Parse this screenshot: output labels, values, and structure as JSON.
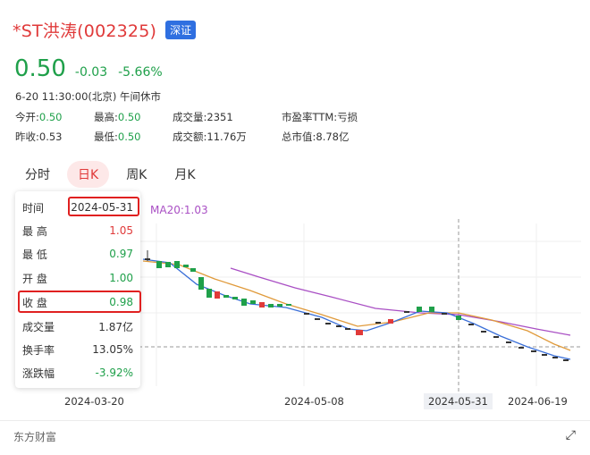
{
  "header": {
    "stock_name": "*ST洪涛(002325)",
    "exchange_badge": "深证",
    "price": "0.50",
    "change": "-0.03",
    "change_pct": "-5.66%",
    "time_status": "6-20 11:30:00(北京) 午间休市"
  },
  "stats": {
    "open_label": "今开:",
    "open_value": "0.50",
    "high_label": "最高:",
    "high_value": "0.50",
    "volume_label": "成交量:",
    "volume_value": "2351",
    "pe_label": "市盈率TTM:",
    "pe_value": "亏损",
    "prev_close_label": "昨收:",
    "prev_close_value": "0.53",
    "low_label": "最低:",
    "low_value": "0.50",
    "turnover_label": "成交额:",
    "turnover_value": "11.76万",
    "mcap_label": "总市值:",
    "mcap_value": "8.78亿"
  },
  "tabs": [
    "分时",
    "日K",
    "周K",
    "月K"
  ],
  "active_tab": "日K",
  "ma_label": "MA20:1.03",
  "tooltip": {
    "time_label": "时间",
    "time_value": "2024-05-31",
    "high_label": "最 高",
    "high_value": "1.05",
    "low_label": "最 低",
    "low_value": "0.97",
    "open_label": "开 盘",
    "open_value": "1.00",
    "close_label": "收 盘",
    "close_value": "0.98",
    "volume_label": "成交量",
    "volume_value": "1.87亿",
    "turnover_label": "换手率",
    "turnover_value": "13.05%",
    "change_label": "涨跌幅",
    "change_value": "-3.92%"
  },
  "xaxis": [
    "2024-03-20",
    "2024-05-08",
    "2024-05-31",
    "2024-06-19"
  ],
  "footer": {
    "brand": "东方财富",
    "expand_icon": "⤢"
  },
  "colors": {
    "up": "#e03a3a",
    "down": "#1fa04a",
    "ma5": "#3a6fd8",
    "ma10": "#e09a3a",
    "ma20": "#a94fc4"
  }
}
